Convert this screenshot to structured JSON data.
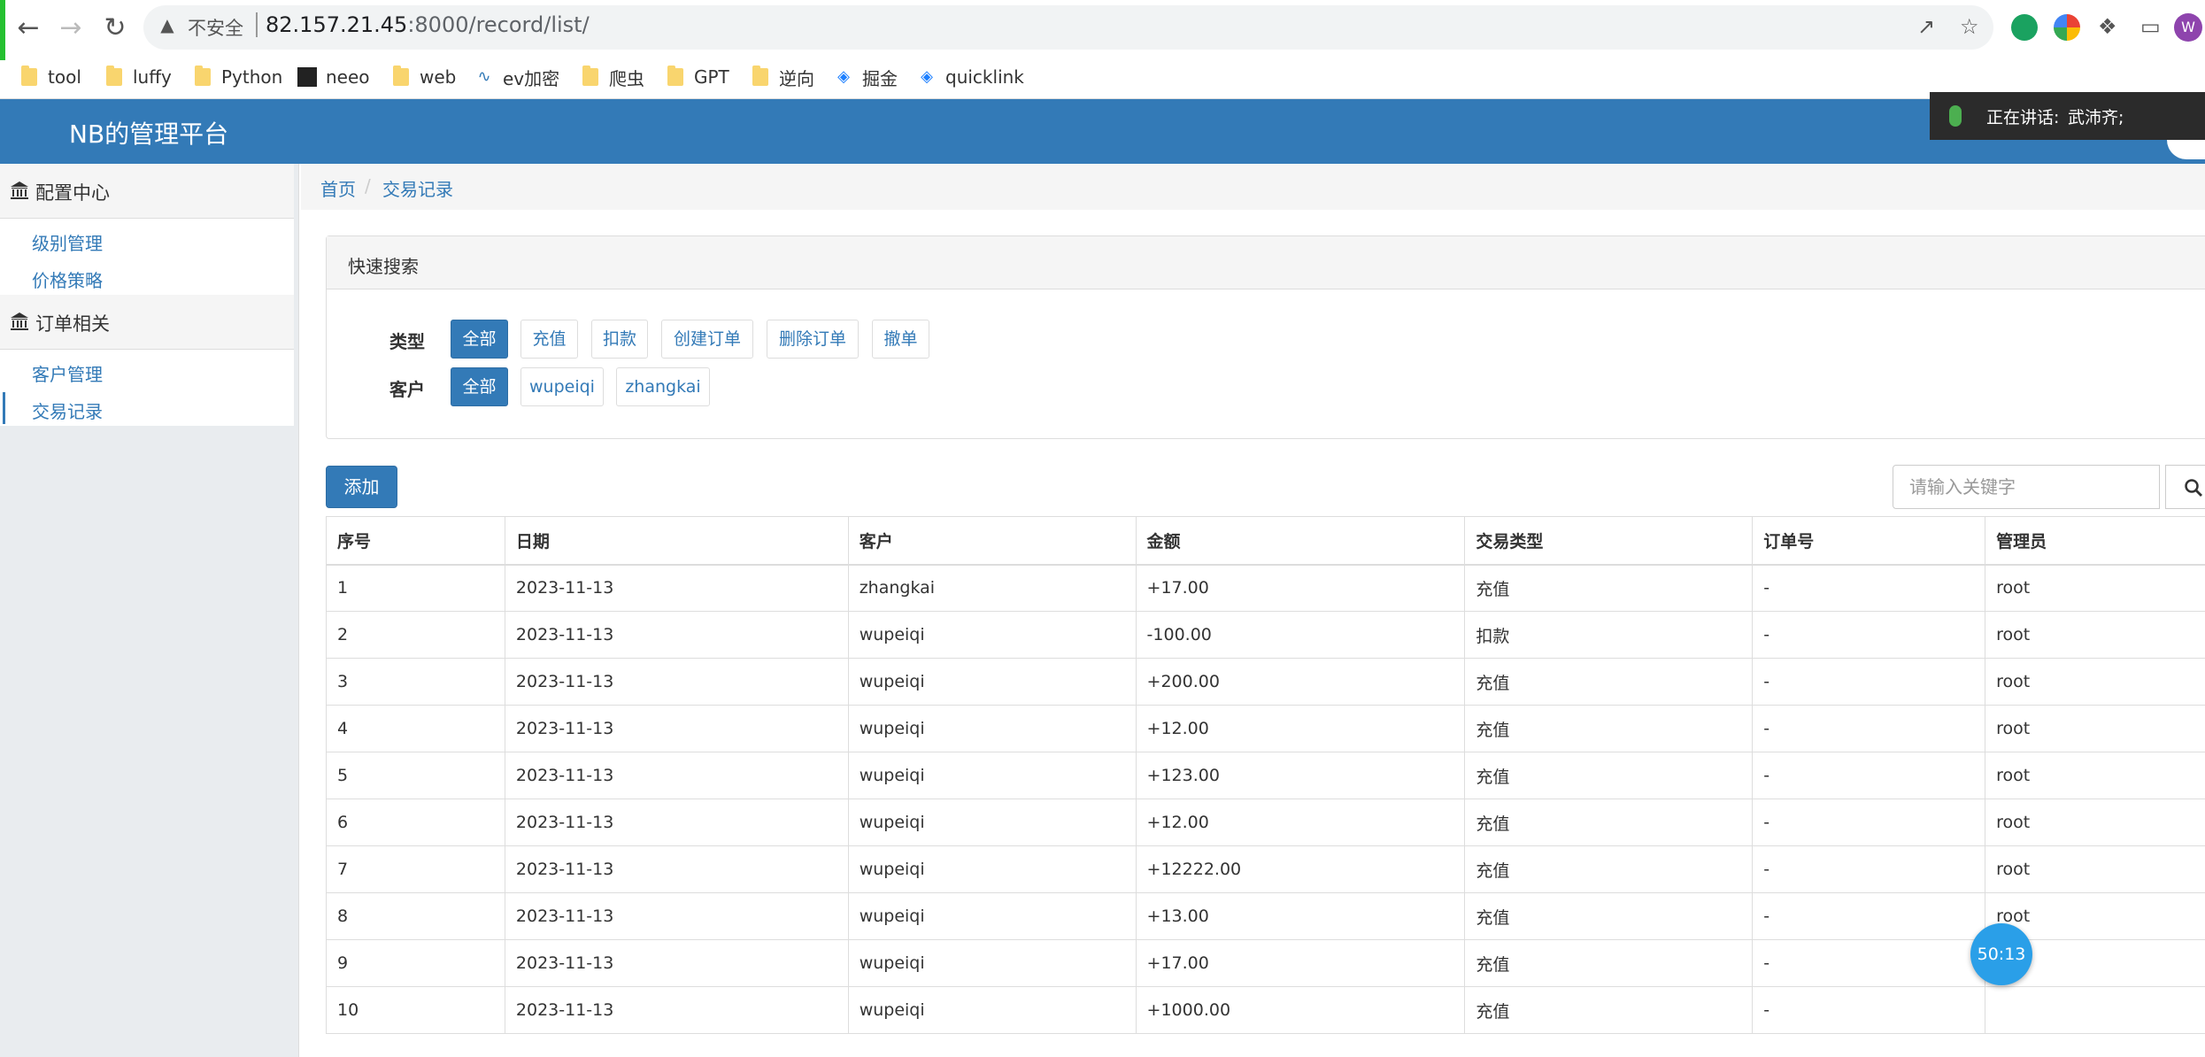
{
  "browser": {
    "insecure_label": "不安全",
    "url_host": "82.157.21.45",
    "url_path": ":8000/record/list/",
    "profile_initial": "W"
  },
  "bookmarks": [
    {
      "label": "tool",
      "icon": "folder-icon"
    },
    {
      "label": "luffy",
      "icon": "folder-icon"
    },
    {
      "label": "Python",
      "icon": "folder-icon"
    },
    {
      "label": "neeo",
      "icon": "neeo-icon"
    },
    {
      "label": "web",
      "icon": "folder-icon"
    },
    {
      "label": "ev加密",
      "icon": "ev-icon"
    },
    {
      "label": "爬虫",
      "icon": "folder-icon"
    },
    {
      "label": "GPT",
      "icon": "folder-icon"
    },
    {
      "label": "逆向",
      "icon": "folder-icon"
    },
    {
      "label": "掘金",
      "icon": "juejin-icon"
    },
    {
      "label": "quicklink",
      "icon": "juejin-icon"
    }
  ],
  "app": {
    "brand": "NB的管理平台"
  },
  "speaking": {
    "label": "正在讲话:",
    "name": "武沛齐;"
  },
  "sidebar": {
    "groups": [
      {
        "title": "配置中心",
        "items": [
          "级别管理",
          "价格策略"
        ]
      },
      {
        "title": "订单相关",
        "items": [
          "客户管理",
          "交易记录"
        ]
      }
    ]
  },
  "breadcrumb": [
    "首页",
    "交易记录"
  ],
  "search_panel": {
    "title": "快速搜索",
    "type_label": "类型",
    "type_options": [
      "全部",
      "充值",
      "扣款",
      "创建订单",
      "删除订单",
      "撤单"
    ],
    "customer_label": "客户",
    "customer_options": [
      "全部",
      "wupeiqi",
      "zhangkai"
    ]
  },
  "toolbar": {
    "add_label": "添加",
    "search_placeholder": "请输入关键字"
  },
  "table": {
    "headers": [
      "序号",
      "日期",
      "客户",
      "金额",
      "交易类型",
      "订单号",
      "管理员"
    ],
    "rows": [
      [
        "1",
        "2023-11-13",
        "zhangkai",
        "+17.00",
        "充值",
        "-",
        "root"
      ],
      [
        "2",
        "2023-11-13",
        "wupeiqi",
        "-100.00",
        "扣款",
        "-",
        "root"
      ],
      [
        "3",
        "2023-11-13",
        "wupeiqi",
        "+200.00",
        "充值",
        "-",
        "root"
      ],
      [
        "4",
        "2023-11-13",
        "wupeiqi",
        "+12.00",
        "充值",
        "-",
        "root"
      ],
      [
        "5",
        "2023-11-13",
        "wupeiqi",
        "+123.00",
        "充值",
        "-",
        "root"
      ],
      [
        "6",
        "2023-11-13",
        "wupeiqi",
        "+12.00",
        "充值",
        "-",
        "root"
      ],
      [
        "7",
        "2023-11-13",
        "wupeiqi",
        "+12222.00",
        "充值",
        "-",
        "root"
      ],
      [
        "8",
        "2023-11-13",
        "wupeiqi",
        "+13.00",
        "充值",
        "-",
        "root"
      ],
      [
        "9",
        "2023-11-13",
        "wupeiqi",
        "+17.00",
        "充值",
        "-",
        ""
      ],
      [
        "10",
        "2023-11-13",
        "wupeiqi",
        "+1000.00",
        "充值",
        "-",
        ""
      ]
    ]
  },
  "timer": "50:13",
  "colors": {
    "primary": "#337ab7",
    "navbar": "#337ab7",
    "sidebar_bg": "#e9ecef",
    "timer": "#2a9fe8"
  }
}
